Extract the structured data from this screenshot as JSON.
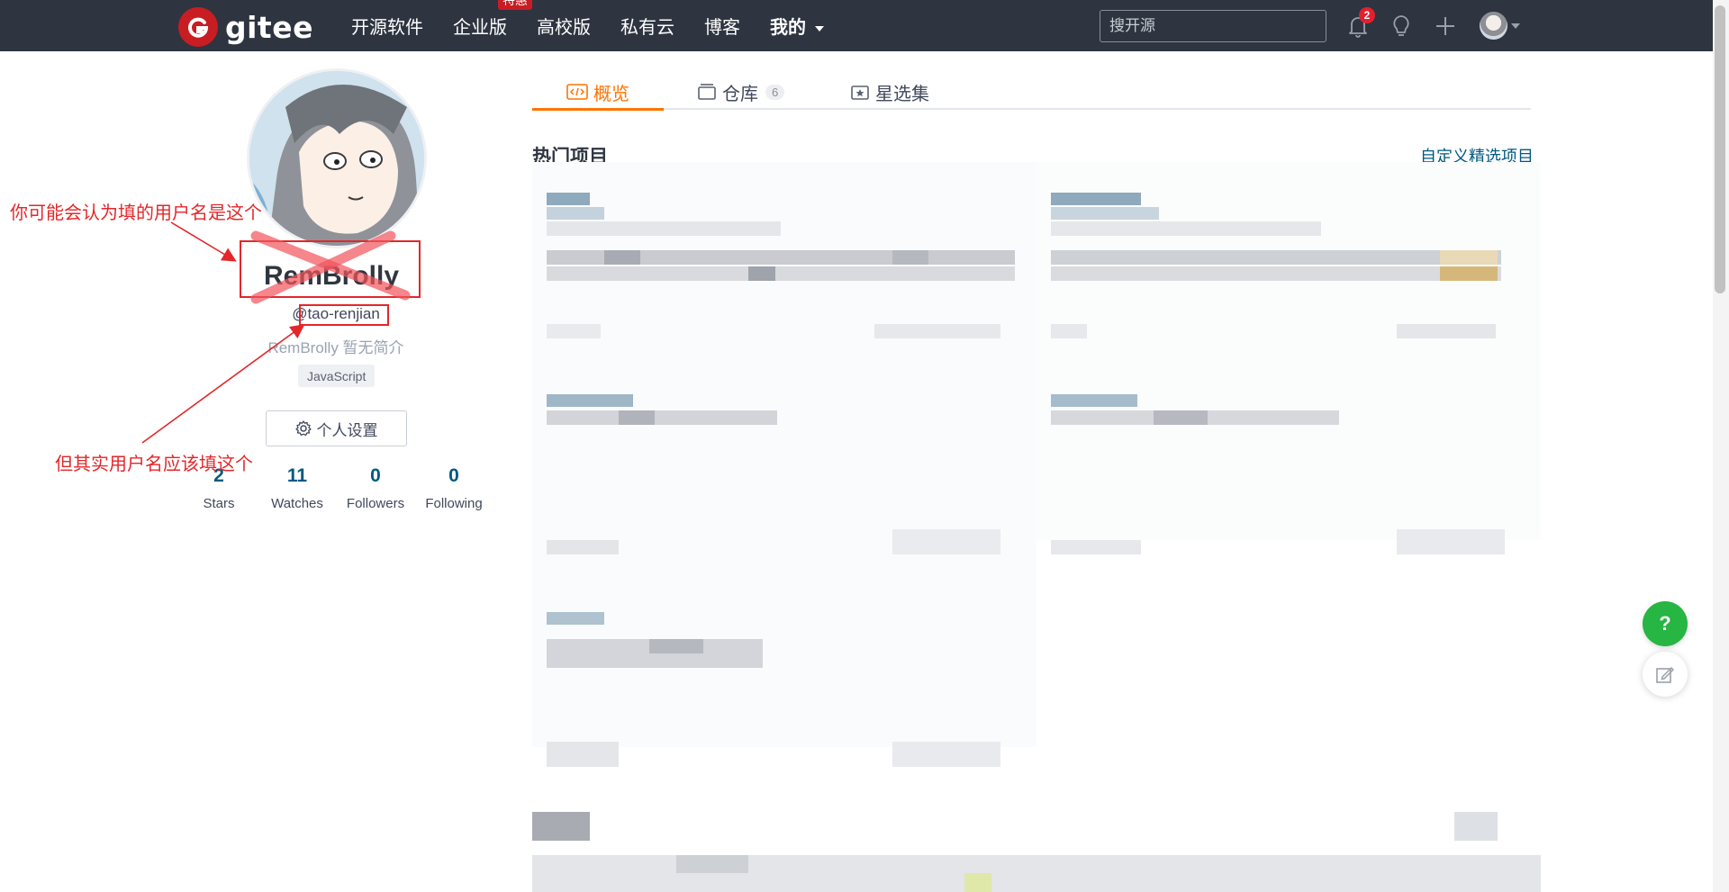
{
  "nav": {
    "logo_text": "gitee",
    "items": [
      {
        "label": "开源软件"
      },
      {
        "label": "企业版",
        "badge": "特惠"
      },
      {
        "label": "高校版"
      },
      {
        "label": "私有云"
      },
      {
        "label": "博客"
      },
      {
        "label": "我的"
      }
    ],
    "search_placeholder": "搜开源",
    "notification_count": "2",
    "icons": [
      "bell-icon",
      "lightbulb-icon",
      "plus-icon"
    ]
  },
  "profile": {
    "display_name": "RemBrolly",
    "username": "@tao-renjian",
    "bio": "RemBrolly 暂无简介",
    "language_tag": "JavaScript",
    "settings_button": "个人设置",
    "stats": [
      {
        "value": "2",
        "label": "Stars"
      },
      {
        "value": "11",
        "label": "Watches"
      },
      {
        "value": "0",
        "label": "Followers"
      },
      {
        "value": "0",
        "label": "Following"
      }
    ]
  },
  "annotations": {
    "wrong_label": "你可能会认为填的用户名是这个",
    "right_label": "但其实用户名应该填这个"
  },
  "tabs": [
    {
      "label": "概览",
      "active": true
    },
    {
      "label": "仓库",
      "count": "6"
    },
    {
      "label": "星选集"
    }
  ],
  "section": {
    "title": "热门项目",
    "link": "自定义精选项目"
  },
  "floating": {
    "help": "?"
  },
  "colors": {
    "navbar": "#2e3440",
    "brand_red": "#c71d23",
    "accent_orange": "#fe7300",
    "link_blue": "#005980",
    "annotation_red": "#e3272a",
    "help_green": "#27b543"
  }
}
